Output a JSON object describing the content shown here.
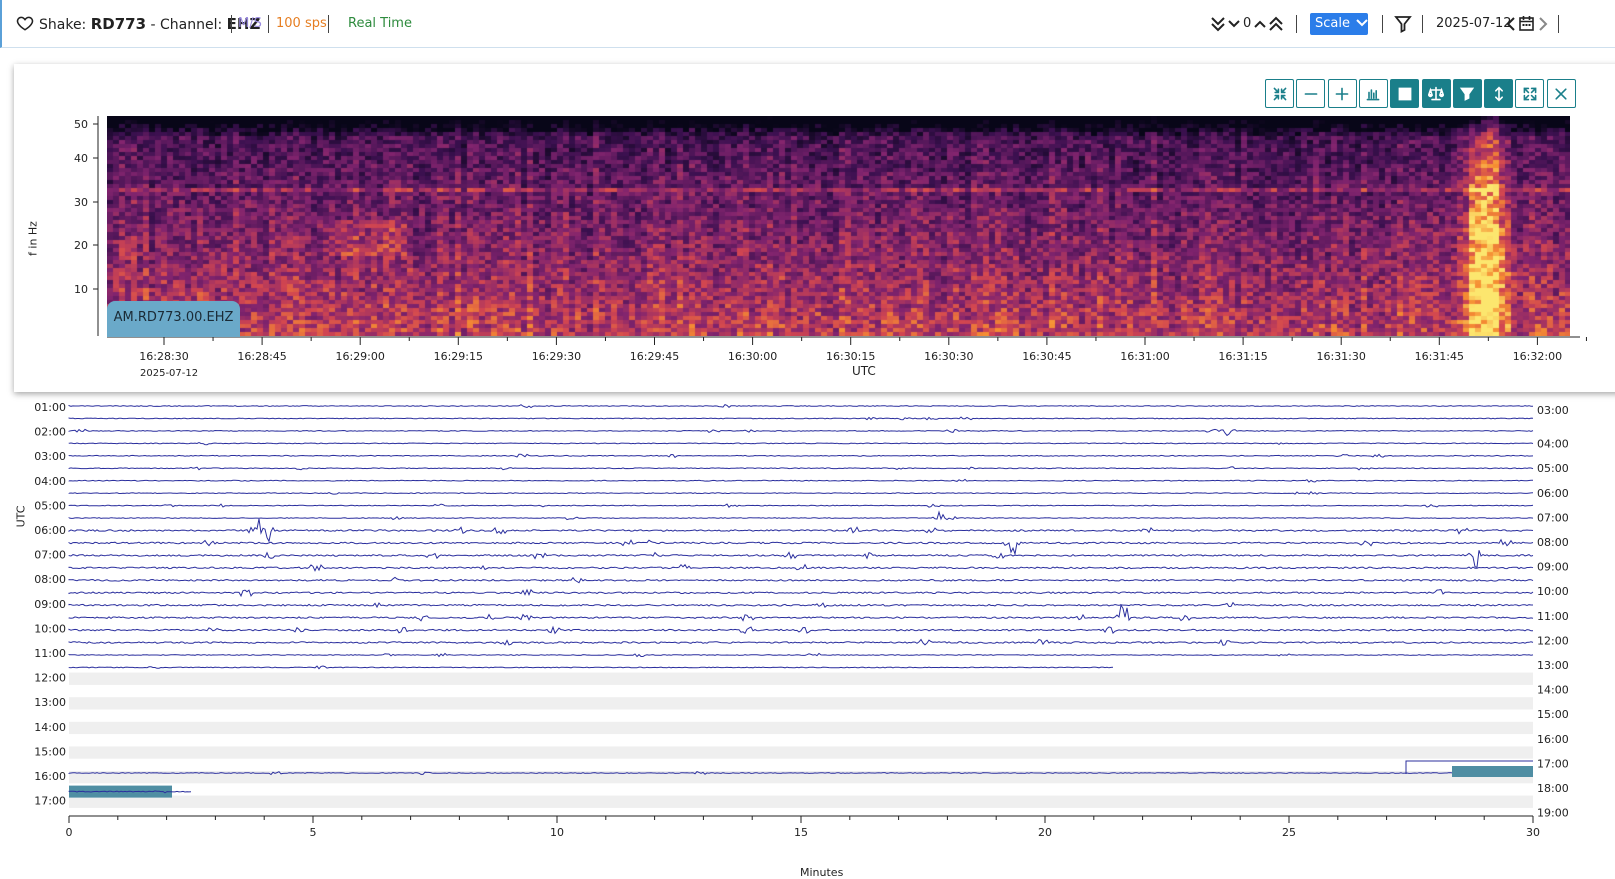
{
  "header": {
    "shake_prefix": "Shake:",
    "station": "RD773",
    "channel_prefix": "- Channel:",
    "channel": "EHZ",
    "units": "M/S",
    "rate": "100 sps",
    "realtime": "Real Time",
    "scale_count": "0",
    "scale_label": "Scale",
    "date": "2025-07-12",
    "colors": {
      "units": "#9b8be0",
      "rate": "#e67e22",
      "realtime": "#2e8b3e",
      "scale_button": "#2b7de9"
    }
  },
  "toolbar": {
    "buttons": [
      {
        "icon": "compress-icon",
        "active": false
      },
      {
        "icon": "minus-icon",
        "active": false
      },
      {
        "icon": "plus-icon",
        "active": false
      },
      {
        "icon": "bar-chart-icon",
        "active": false
      },
      {
        "icon": "grid-icon",
        "active": true
      },
      {
        "icon": "balance-scale-icon",
        "active": true
      },
      {
        "icon": "filter-icon",
        "active": true
      },
      {
        "icon": "vertical-arrows-icon",
        "active": true
      },
      {
        "icon": "expand-icon",
        "active": false
      },
      {
        "icon": "close-icon",
        "active": false
      }
    ]
  },
  "spectrogram": {
    "ylabel": "f in Hz",
    "yticks": [
      "50",
      "40",
      "30",
      "20",
      "10"
    ],
    "xticks": [
      "16:28:30",
      "16:28:45",
      "16:29:00",
      "16:29:15",
      "16:29:30",
      "16:29:45",
      "16:30:00",
      "16:30:15",
      "16:30:30",
      "16:30:45",
      "16:31:00",
      "16:31:15",
      "16:31:30",
      "16:31:45",
      "16:32:00"
    ],
    "first_date": "2025-07-12",
    "xlabel": "UTC",
    "badge": "AM.RD773.00.EHZ"
  },
  "helicorder": {
    "ylabel": "UTC",
    "left_labels": [
      "01:00",
      "02:00",
      "03:00",
      "04:00",
      "05:00",
      "06:00",
      "07:00",
      "08:00",
      "09:00",
      "10:00",
      "11:00",
      "12:00",
      "13:00",
      "14:00",
      "15:00",
      "16:00",
      "17:00"
    ],
    "right_labels": [
      "03:00",
      "04:00",
      "05:00",
      "06:00",
      "07:00",
      "08:00",
      "09:00",
      "10:00",
      "11:00",
      "12:00",
      "13:00",
      "14:00",
      "15:00",
      "16:00",
      "17:00",
      "18:00",
      "19:00"
    ],
    "xticks": [
      "0",
      "5",
      "10",
      "15",
      "20",
      "25",
      "30"
    ],
    "xlabel": "Minutes",
    "trace_color": "#2b2f9e",
    "highlight_color": "#4f8ea3"
  }
}
